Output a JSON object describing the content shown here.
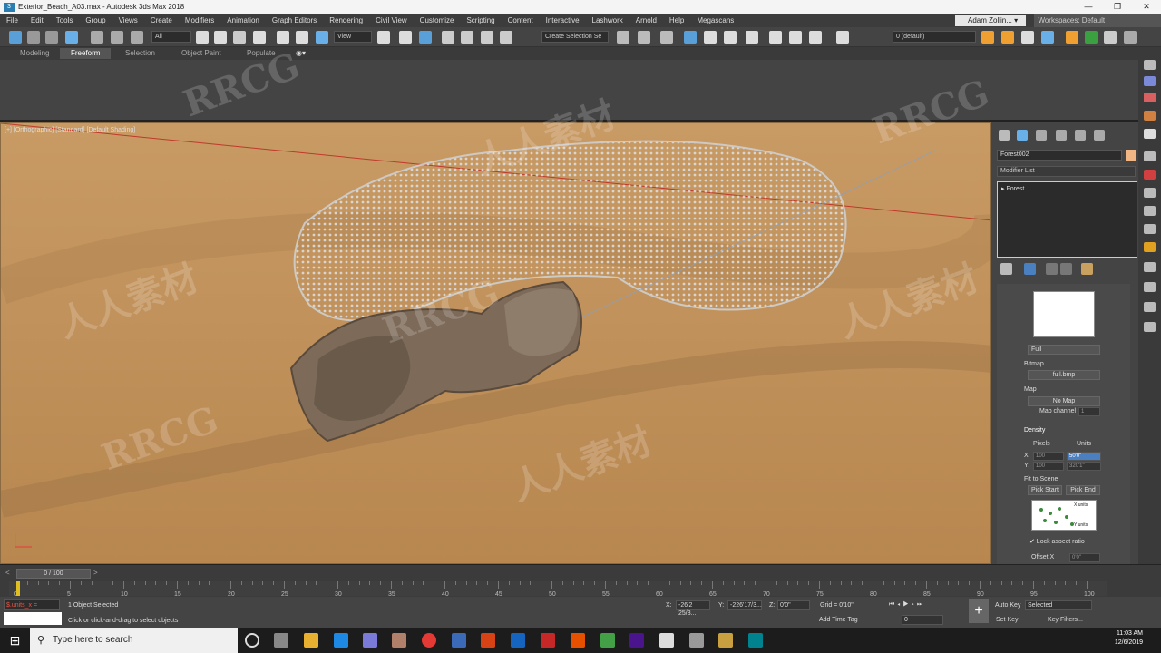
{
  "window": {
    "title": "Exterior_Beach_A03.max - Autodesk 3ds Max 2018",
    "controls": [
      "—",
      "❐",
      "✕"
    ]
  },
  "menu": [
    "File",
    "Edit",
    "Tools",
    "Group",
    "Views",
    "Create",
    "Modifiers",
    "Animation",
    "Graph Editors",
    "Rendering",
    "Civil View",
    "Customize",
    "Scripting",
    "Content",
    "Interactive",
    "Lashwork",
    "Arnold",
    "Help",
    "Megascans"
  ],
  "user": "Adam Zollin...",
  "workspace": "Workspaces: Default",
  "toolbar": {
    "filter": "All",
    "refcoord": "View",
    "selset": "Create Selection Se",
    "layer": "0 (default)"
  },
  "ribbon_tabs": [
    "Modeling",
    "Freeform",
    "Selection",
    "Object Paint",
    "Populate"
  ],
  "viewport": {
    "label": "[+] [Orthographic] [Standard] [Default Shading]"
  },
  "panel": {
    "object_name": "Forest002",
    "modifier_list": "Modifier List",
    "stack_item": "Forest",
    "mode": "Full",
    "bitmap_label": "Bitmap",
    "bitmap_value": "full.bmp",
    "map_label": "Map",
    "map_value": "No Map",
    "map_channel": "Map channel",
    "map_channel_value": "1",
    "density_label": "Density",
    "pixels": "Pixels",
    "units": "Units",
    "x_label": "X:",
    "x_pixels": "100",
    "x_units": "50'0\"",
    "y_label": "Y:",
    "y_pixels": "100",
    "y_units": "320'1\"",
    "fit_label": "Fit to Scene",
    "pick_start": "Pick Start",
    "pick_end": "Pick End",
    "diagram_x": "X units",
    "diagram_y": "Y units",
    "lock_aspect": "✔ Lock aspect ratio",
    "offset": "Offset X",
    "offset_value": "0'0\""
  },
  "timeline": {
    "frame": "0 / 100",
    "ticks": [
      "0",
      "5",
      "10",
      "15",
      "20",
      "25",
      "30",
      "35",
      "40",
      "45",
      "50",
      "55",
      "60",
      "65",
      "70",
      "75",
      "80",
      "85",
      "90",
      "95",
      "100"
    ]
  },
  "status": {
    "maxscript": "$.units_x = ",
    "selected": "1 Object Selected",
    "hint": "Click or click-and-drag to select objects",
    "x_label": "X:",
    "x": "-26'2 25/3...",
    "y_label": "Y:",
    "y": "-226'17/3...",
    "z_label": "Z:",
    "z": "0'0\"",
    "grid": "Grid = 0'10\"",
    "time_tag": "Add Time Tag",
    "autokey": "Auto Key",
    "setkey": "Set Key",
    "selected_dd": "Selected",
    "key_filters": "Key Filters...",
    "frame_field": "0"
  },
  "taskbar": {
    "search": "Type here to search",
    "time": "11:03 AM",
    "date": "12/6/2019"
  },
  "watermarks": [
    "RRCG",
    "人人素材",
    "RRCG",
    "人人素材",
    "RRCG",
    "人人素材",
    "RRCG",
    "人人素材"
  ]
}
